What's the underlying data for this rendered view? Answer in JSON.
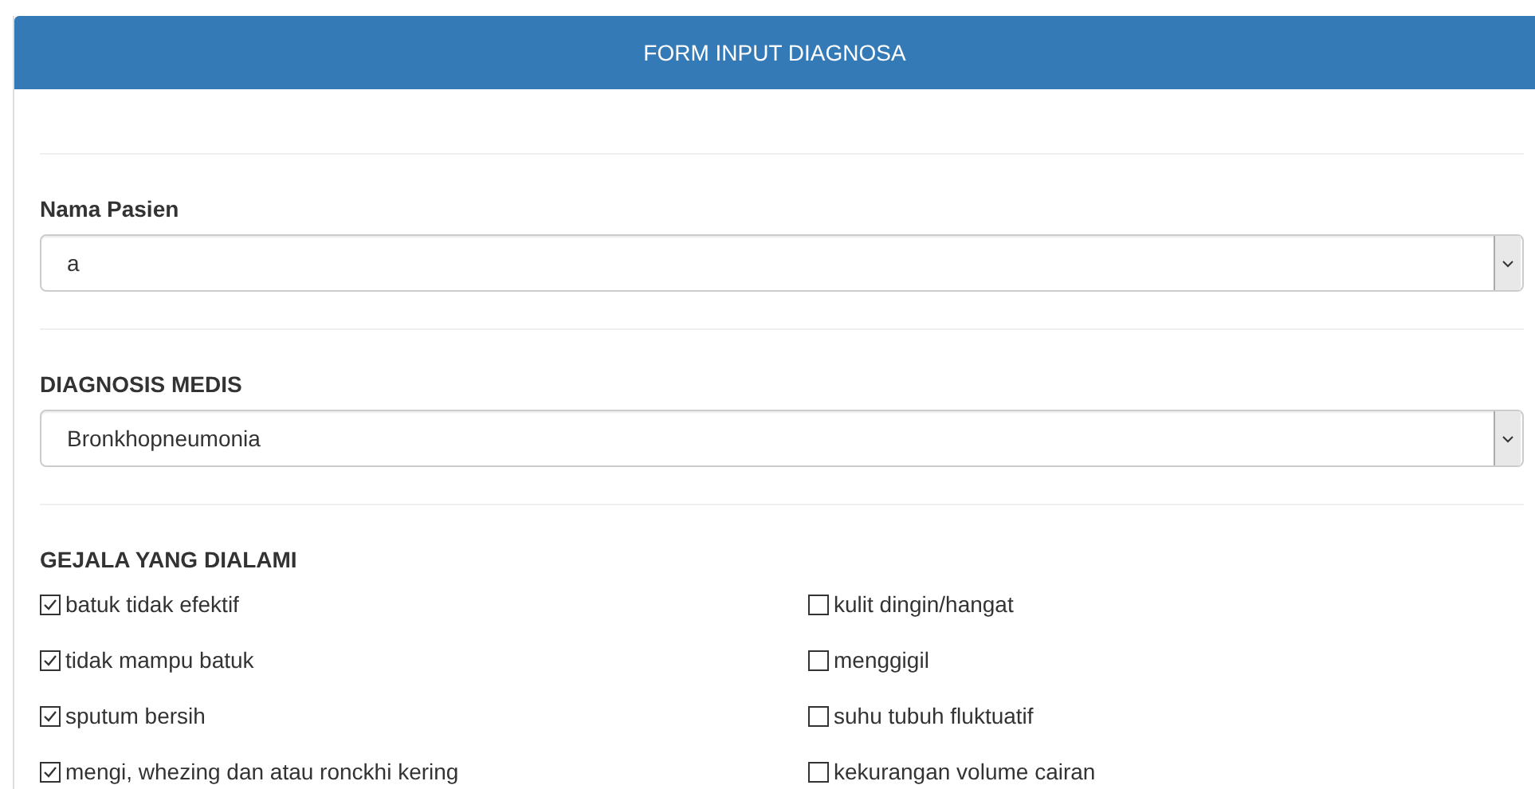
{
  "panel": {
    "title": "FORM INPUT DIAGNOSA"
  },
  "fields": [
    {
      "label": "Nama Pasien",
      "value": "a"
    },
    {
      "label": "DIAGNOSIS MEDIS",
      "value": "Bronkhopneumonia"
    }
  ],
  "symptoms": {
    "label": "GEJALA YANG DIALAMI",
    "items": [
      {
        "label": "batuk tidak efektif",
        "checked": true
      },
      {
        "label": "kulit dingin/hangat",
        "checked": false
      },
      {
        "label": "tidak mampu batuk",
        "checked": true
      },
      {
        "label": "menggigil",
        "checked": false
      },
      {
        "label": "sputum bersih",
        "checked": true
      },
      {
        "label": "suhu tubuh fluktuatif",
        "checked": false
      },
      {
        "label": "mengi, whezing dan atau ronckhi kering",
        "checked": true
      },
      {
        "label": "kekurangan volume cairan",
        "checked": false
      }
    ]
  }
}
